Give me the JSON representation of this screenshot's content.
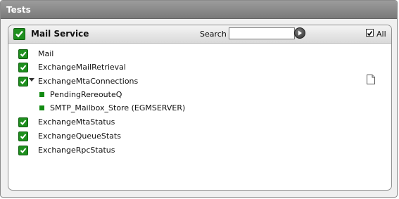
{
  "window": {
    "title": "Tests"
  },
  "panel": {
    "title": "Mail Service",
    "search_label": "Search",
    "search_value": "",
    "all_label": "All",
    "all_checked": true
  },
  "tests": [
    {
      "label": "Mail",
      "checked": true
    },
    {
      "label": "ExchangeMailRetrieval",
      "checked": true
    },
    {
      "label": "ExchangeMtaConnections",
      "checked": true,
      "expanded": true,
      "children": [
        {
          "label": "PendingRereouteQ"
        },
        {
          "label": "SMTP_Mailbox_Store (EGMSERVER)"
        }
      ]
    },
    {
      "label": "ExchangeMtaStatus",
      "checked": true
    },
    {
      "label": "ExchangeQueueStats",
      "checked": true
    },
    {
      "label": "ExchangeRpcStatus",
      "checked": true
    }
  ],
  "colors": {
    "check_green": "#1e8f1e",
    "title_bar": "#8a8a8a"
  },
  "icons": {
    "expand": "chevron-down-icon",
    "details": "document-icon",
    "go": "go-arrow-icon"
  }
}
